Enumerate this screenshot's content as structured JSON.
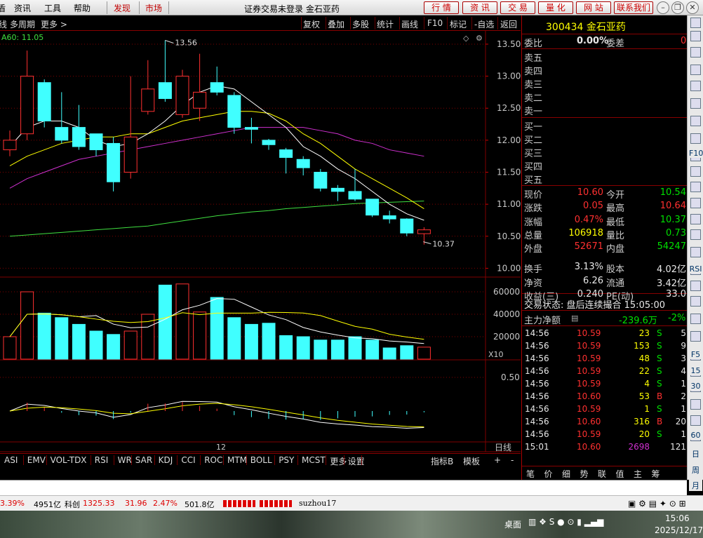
{
  "menubar": {
    "items": [
      "盾",
      "资讯",
      "工具",
      "帮助",
      "发现",
      "市场"
    ],
    "title": "证券交易未登录  金石亚药",
    "buttons": [
      "行 情",
      "资 讯",
      "交 易",
      "量 化",
      "网 站",
      "联系我们"
    ]
  },
  "toolbar": {
    "left": [
      "线",
      "多周期",
      "更多 >"
    ],
    "right": [
      "复权",
      "叠加",
      "多股",
      "统计",
      "画线",
      "F10",
      "标记",
      "-自选",
      "返回"
    ]
  },
  "chart": {
    "ma_label": "A60: 11.05",
    "high_label": "13.56",
    "low_label": "10.37",
    "price_axis": [
      "13.50",
      "13.00",
      "12.50",
      "12.00",
      "11.50",
      "11.00",
      "10.50",
      "10.00"
    ],
    "vol_axis": [
      "60000",
      "40000",
      "20000"
    ],
    "vol_unit": "X10",
    "ind_axis": [
      "0.50"
    ],
    "date_label": "12",
    "period": "日线",
    "colors": {
      "up": "#ff3030",
      "down": "#40ffff",
      "ma5": "#ffffff",
      "ma10": "#ffff00",
      "ma20": "#d030d0",
      "ma60": "#40e040",
      "grid": "#800000"
    }
  },
  "chart_data": {
    "type": "candlestick",
    "candles": [
      {
        "o": 11.85,
        "c": 12.0,
        "h": 12.15,
        "l": 11.75
      },
      {
        "o": 12.1,
        "c": 13.0,
        "h": 13.4,
        "l": 12.0
      },
      {
        "o": 12.9,
        "c": 12.3,
        "h": 12.95,
        "l": 12.2
      },
      {
        "o": 12.2,
        "c": 12.0,
        "h": 12.75,
        "l": 11.95
      },
      {
        "o": 12.2,
        "c": 11.9,
        "h": 12.55,
        "l": 11.85
      },
      {
        "o": 12.1,
        "c": 11.85,
        "h": 12.1,
        "l": 11.75
      },
      {
        "o": 11.95,
        "c": 11.35,
        "h": 12.05,
        "l": 11.2
      },
      {
        "o": 11.5,
        "c": 12.05,
        "h": 13.0,
        "l": 11.4
      },
      {
        "o": 12.45,
        "c": 12.8,
        "h": 13.25,
        "l": 12.4
      },
      {
        "o": 12.9,
        "c": 12.65,
        "h": 13.56,
        "l": 12.6
      },
      {
        "o": 12.4,
        "c": 13.0,
        "h": 13.1,
        "l": 12.35
      },
      {
        "o": 12.5,
        "c": 12.75,
        "h": 13.35,
        "l": 12.3
      },
      {
        "o": 12.9,
        "c": 12.75,
        "h": 13.15,
        "l": 12.7
      },
      {
        "o": 12.7,
        "c": 12.2,
        "h": 12.75,
        "l": 12.1
      },
      {
        "o": 12.2,
        "c": 12.17,
        "h": 12.35,
        "l": 11.95
      },
      {
        "o": 12.0,
        "c": 11.93,
        "h": 12.02,
        "l": 11.85
      },
      {
        "o": 11.85,
        "c": 11.73,
        "h": 11.88,
        "l": 11.48
      },
      {
        "o": 11.7,
        "c": 11.57,
        "h": 11.75,
        "l": 11.45
      },
      {
        "o": 11.5,
        "c": 11.25,
        "h": 11.55,
        "l": 11.2
      },
      {
        "o": 11.25,
        "c": 11.2,
        "h": 11.3,
        "l": 11.05
      },
      {
        "o": 11.2,
        "c": 11.08,
        "h": 11.55,
        "l": 11.05
      },
      {
        "o": 11.08,
        "c": 10.83,
        "h": 11.08,
        "l": 10.8
      },
      {
        "o": 10.82,
        "c": 10.77,
        "h": 10.9,
        "l": 10.7
      },
      {
        "o": 10.77,
        "c": 10.55,
        "h": 10.78,
        "l": 10.5
      },
      {
        "o": 10.54,
        "c": 10.6,
        "h": 10.64,
        "l": 10.37
      }
    ],
    "volumes": [
      20000,
      60000,
      41000,
      37000,
      31000,
      25000,
      22000,
      25000,
      40000,
      66000,
      67000,
      42000,
      55000,
      37000,
      31000,
      32000,
      21000,
      20000,
      17000,
      17000,
      20000,
      17000,
      10000,
      12000,
      10692
    ],
    "ma_lines": {
      "ma5": [
        11.9,
        12.2,
        12.3,
        12.3,
        12.2,
        12.0,
        11.9,
        11.95,
        12.1,
        12.3,
        12.55,
        12.75,
        12.85,
        12.8,
        12.6,
        12.4,
        12.2,
        11.9,
        11.75,
        11.55,
        11.4,
        11.2,
        11.0,
        10.85,
        10.75
      ],
      "ma10": [
        11.6,
        11.75,
        11.85,
        11.95,
        12.0,
        12.05,
        12.05,
        12.1,
        12.1,
        12.2,
        12.3,
        12.35,
        12.4,
        12.45,
        12.45,
        12.42,
        12.3,
        12.1,
        11.95,
        11.75,
        11.55,
        11.4,
        11.25,
        11.1,
        10.93
      ],
      "ma20": [
        11.25,
        11.4,
        11.5,
        11.6,
        11.7,
        11.75,
        11.8,
        11.85,
        11.9,
        11.95,
        12.0,
        12.05,
        12.1,
        12.15,
        12.2,
        12.2,
        12.2,
        12.2,
        12.15,
        12.1,
        12.0,
        11.95,
        11.85,
        11.8,
        11.75
      ],
      "ma60": [
        10.5,
        10.52,
        10.54,
        10.56,
        10.58,
        10.6,
        10.62,
        10.64,
        10.66,
        10.7,
        10.74,
        10.78,
        10.82,
        10.85,
        10.88,
        10.9,
        10.93,
        10.95,
        10.97,
        10.99,
        11.01,
        11.02,
        11.03,
        11.04,
        11.05
      ]
    },
    "ylim": [
      9.95,
      13.62
    ]
  },
  "quote": {
    "code": "300434",
    "name": "金石亚药",
    "weibi_label": "委比",
    "weibi": "0.00%",
    "weicha_label": "委差",
    "weicha": "0",
    "sells": [
      "卖五",
      "卖四",
      "卖三",
      "卖二",
      "卖一"
    ],
    "buys": [
      "买一",
      "买二",
      "买三",
      "买四",
      "买五"
    ],
    "rows": [
      {
        "l1": "现价",
        "v1": "10.60",
        "l2": "今开",
        "v2": "10.54"
      },
      {
        "l1": "涨跌",
        "v1": "0.05",
        "l2": "最高",
        "v2": "10.64"
      },
      {
        "l1": "涨幅",
        "v1": "0.47%",
        "l2": "最低",
        "v2": "10.37"
      },
      {
        "l1": "总量",
        "v1": "106918",
        "l2": "量比",
        "v2": "0.73"
      },
      {
        "l1": "外盘",
        "v1": "52671",
        "l2": "内盘",
        "v2": "54247"
      },
      {
        "l1": "换手",
        "v1": "3.13%",
        "l2": "股本",
        "v2": "4.02亿"
      },
      {
        "l1": "净资",
        "v1": "6.26",
        "l2": "流通",
        "v2": "3.42亿"
      },
      {
        "l1": "收益(三)",
        "v1": "0.240",
        "l2": "PE(动)",
        "v2": "33.0"
      }
    ],
    "status": "交易状态: 盘后连续撮合 15:05:00",
    "netflow_label": "主力净额",
    "netflow": "-239.6万",
    "netflow_pct": "-2%",
    "trades": [
      {
        "t": "14:56",
        "p": "10.59",
        "v": "23",
        "d": "S",
        "n": "5"
      },
      {
        "t": "14:56",
        "p": "10.59",
        "v": "153",
        "d": "S",
        "n": "9"
      },
      {
        "t": "14:56",
        "p": "10.59",
        "v": "48",
        "d": "S",
        "n": "3"
      },
      {
        "t": "14:56",
        "p": "10.59",
        "v": "22",
        "d": "S",
        "n": "4"
      },
      {
        "t": "14:56",
        "p": "10.59",
        "v": "4",
        "d": "S",
        "n": "1"
      },
      {
        "t": "14:56",
        "p": "10.60",
        "v": "53",
        "d": "B",
        "n": "2"
      },
      {
        "t": "14:56",
        "p": "10.59",
        "v": "1",
        "d": "S",
        "n": "1"
      },
      {
        "t": "14:56",
        "p": "10.60",
        "v": "316",
        "d": "B",
        "n": "20"
      },
      {
        "t": "14:56",
        "p": "10.59",
        "v": "20",
        "d": "S",
        "n": "1"
      },
      {
        "t": "15:01",
        "p": "10.60",
        "v": "2698",
        "d": "",
        "n": "121"
      }
    ],
    "tabs": [
      "笔",
      "价",
      "细",
      "势",
      "联",
      "值",
      "主",
      "筹"
    ]
  },
  "indicator_tabs": [
    "ASI",
    "EMV",
    "VOL-TDX",
    "RSI",
    "WR",
    "SAR",
    "KDJ",
    "CCI",
    "ROC",
    "MTM",
    "BOLL",
    "PSY",
    "MCST",
    "更多",
    "设置"
  ],
  "indicator_tabs_right": [
    "指标B",
    "模板",
    "+",
    "-"
  ],
  "statusbar": {
    "s1": "3.39%",
    "s2": "4951亿",
    "s3": "科创",
    "s4": "1325.33",
    "s5": "31.96",
    "s6": "2.47%",
    "s7": "501.8亿",
    "s8": "suzhou17"
  },
  "taskbar": {
    "desktop": "桌面",
    "time": "15:06",
    "date": "2025/12/17"
  },
  "sidebar_icons": [
    "RSI",
    "F10",
    "F5",
    "15",
    "30",
    "60",
    "日",
    "周",
    "月"
  ]
}
